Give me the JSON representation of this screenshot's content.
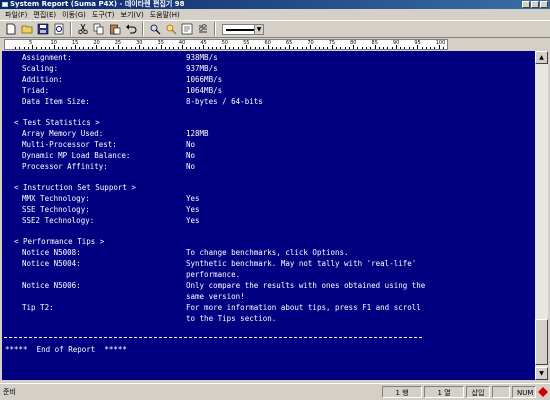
{
  "window": {
    "title": "System Report (Suma P4X) - 데이타렌 편집기 98"
  },
  "menu": [
    "파일(F)",
    "편집(E)",
    "이동(G)",
    "도구(T)",
    "보기(V)",
    "도움말(H)"
  ],
  "toolbar": {
    "icons": [
      "new-file-icon",
      "open-folder-icon",
      "save-icon",
      "print-preview-icon",
      "cut-icon",
      "copy-icon",
      "paste-icon",
      "undo-icon",
      "find-icon",
      "replace-icon",
      "format-icon",
      "settings-icon"
    ],
    "line_style": "solid"
  },
  "ruler": {
    "marks": [
      "5",
      "10",
      "15",
      "20",
      "25",
      "30",
      "35",
      "40",
      "45",
      "50",
      "55",
      "60",
      "65",
      "70",
      "75",
      "80",
      "85",
      "90",
      "95",
      "100"
    ]
  },
  "report": {
    "bandwidth": [
      {
        "label": "Assignment:",
        "value": "938MB/s"
      },
      {
        "label": "Scaling:",
        "value": "937MB/s"
      },
      {
        "label": "Addition:",
        "value": "1066MB/s"
      },
      {
        "label": "Triad:",
        "value": "1064MB/s"
      },
      {
        "label": "Data Item Size:",
        "value": "8-bytes / 64-bits"
      }
    ],
    "test_stats_header": "< Test Statistics >",
    "test_stats": [
      {
        "label": "Array Memory Used:",
        "value": "128MB"
      },
      {
        "label": "Multi-Processor Test:",
        "value": "No"
      },
      {
        "label": "Dynamic MP Load Balance:",
        "value": "No"
      },
      {
        "label": "Processor Affinity:",
        "value": "No"
      }
    ],
    "instruction_header": "< Instruction Set Support >",
    "instructions": [
      {
        "label": "MMX Technology:",
        "value": "Yes"
      },
      {
        "label": "SSE Technology:",
        "value": "Yes"
      },
      {
        "label": "SSE2 Technology:",
        "value": "Yes"
      }
    ],
    "tips_header": "< Performance Tips >",
    "tips": [
      {
        "label": "Notice N5008:",
        "lines": [
          "To change benchmarks, click Options."
        ]
      },
      {
        "label": "Notice N5004:",
        "lines": [
          "Synthetic benchmark. May not tally with 'real-life'",
          "performance."
        ]
      },
      {
        "label": "Notice N5006:",
        "lines": [
          "Only compare the results with ones obtained using the",
          "same version!"
        ]
      },
      {
        "label": "Tip T2:",
        "lines": [
          "For more information about tips, press F1 and scroll",
          "to the Tips section."
        ]
      }
    ],
    "end_text": "*****  End of Report  *****"
  },
  "status": {
    "ready": "준비",
    "line": "1 행",
    "column": "1 열",
    "mode": "삽입",
    "numlock": "NUM"
  },
  "colors": {
    "document_bg": "#000080",
    "document_text": "#ffffff",
    "title_bar": "#0a246a"
  }
}
